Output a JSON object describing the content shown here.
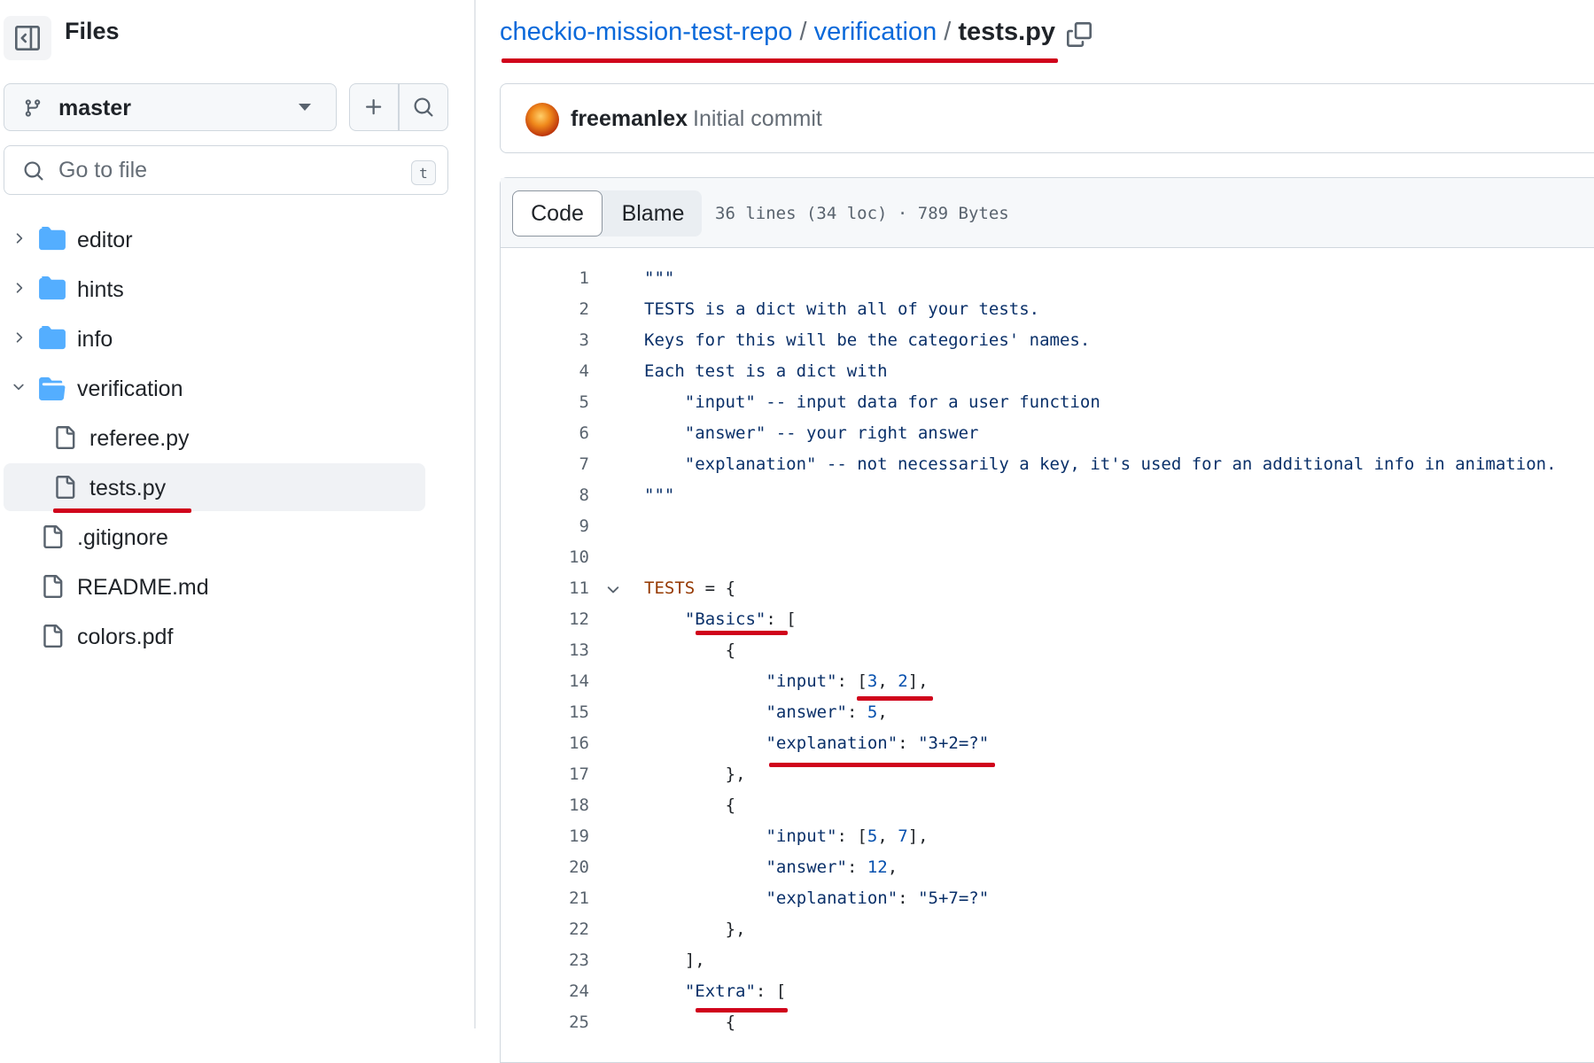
{
  "sidebar": {
    "title": "Files",
    "branch": "master",
    "goto_placeholder": "Go to file",
    "goto_shortcut": "t",
    "tree": [
      {
        "type": "folder",
        "label": "editor",
        "expanded": false
      },
      {
        "type": "folder",
        "label": "hints",
        "expanded": false
      },
      {
        "type": "folder",
        "label": "info",
        "expanded": false
      },
      {
        "type": "folder",
        "label": "verification",
        "expanded": true
      },
      {
        "type": "file",
        "label": "referee.py"
      },
      {
        "type": "file",
        "label": "tests.py",
        "selected": true
      },
      {
        "type": "file",
        "label": ".gitignore"
      },
      {
        "type": "file",
        "label": "README.md"
      },
      {
        "type": "file",
        "label": "colors.pdf"
      }
    ]
  },
  "breadcrumb": {
    "repo": "checkio-mission-test-repo",
    "sep": "/",
    "folder": "verification",
    "file": "tests.py"
  },
  "commit": {
    "author": "freemanlex",
    "message": "Initial commit"
  },
  "file_view": {
    "tabs": [
      "Code",
      "Blame"
    ],
    "active_tab": "Code",
    "meta": "36 lines (34 loc) · 789 Bytes"
  },
  "code_lines": [
    "\"\"\"",
    "TESTS is a dict with all of your tests.",
    "Keys for this will be the categories' names.",
    "Each test is a dict with",
    "    \"input\" -- input data for a user function",
    "    \"answer\" -- your right answer",
    "    \"explanation\" -- not necessarily a key, it's used for an additional info in animation.",
    "\"\"\"",
    "",
    "",
    "TESTS = {",
    "    \"Basics\": [",
    "        {",
    "            \"input\": [3, 2],",
    "            \"answer\": 5,",
    "            \"explanation\": \"3+2=?\"",
    "        },",
    "        {",
    "            \"input\": [5, 7],",
    "            \"answer\": 12,",
    "            \"explanation\": \"5+7=?\"",
    "        },",
    "    ],",
    "    \"Extra\": [",
    "        {"
  ],
  "colors": {
    "link": "#0969da",
    "folder_icon": "#54aeff",
    "annotation_underline": "#d0021b"
  }
}
